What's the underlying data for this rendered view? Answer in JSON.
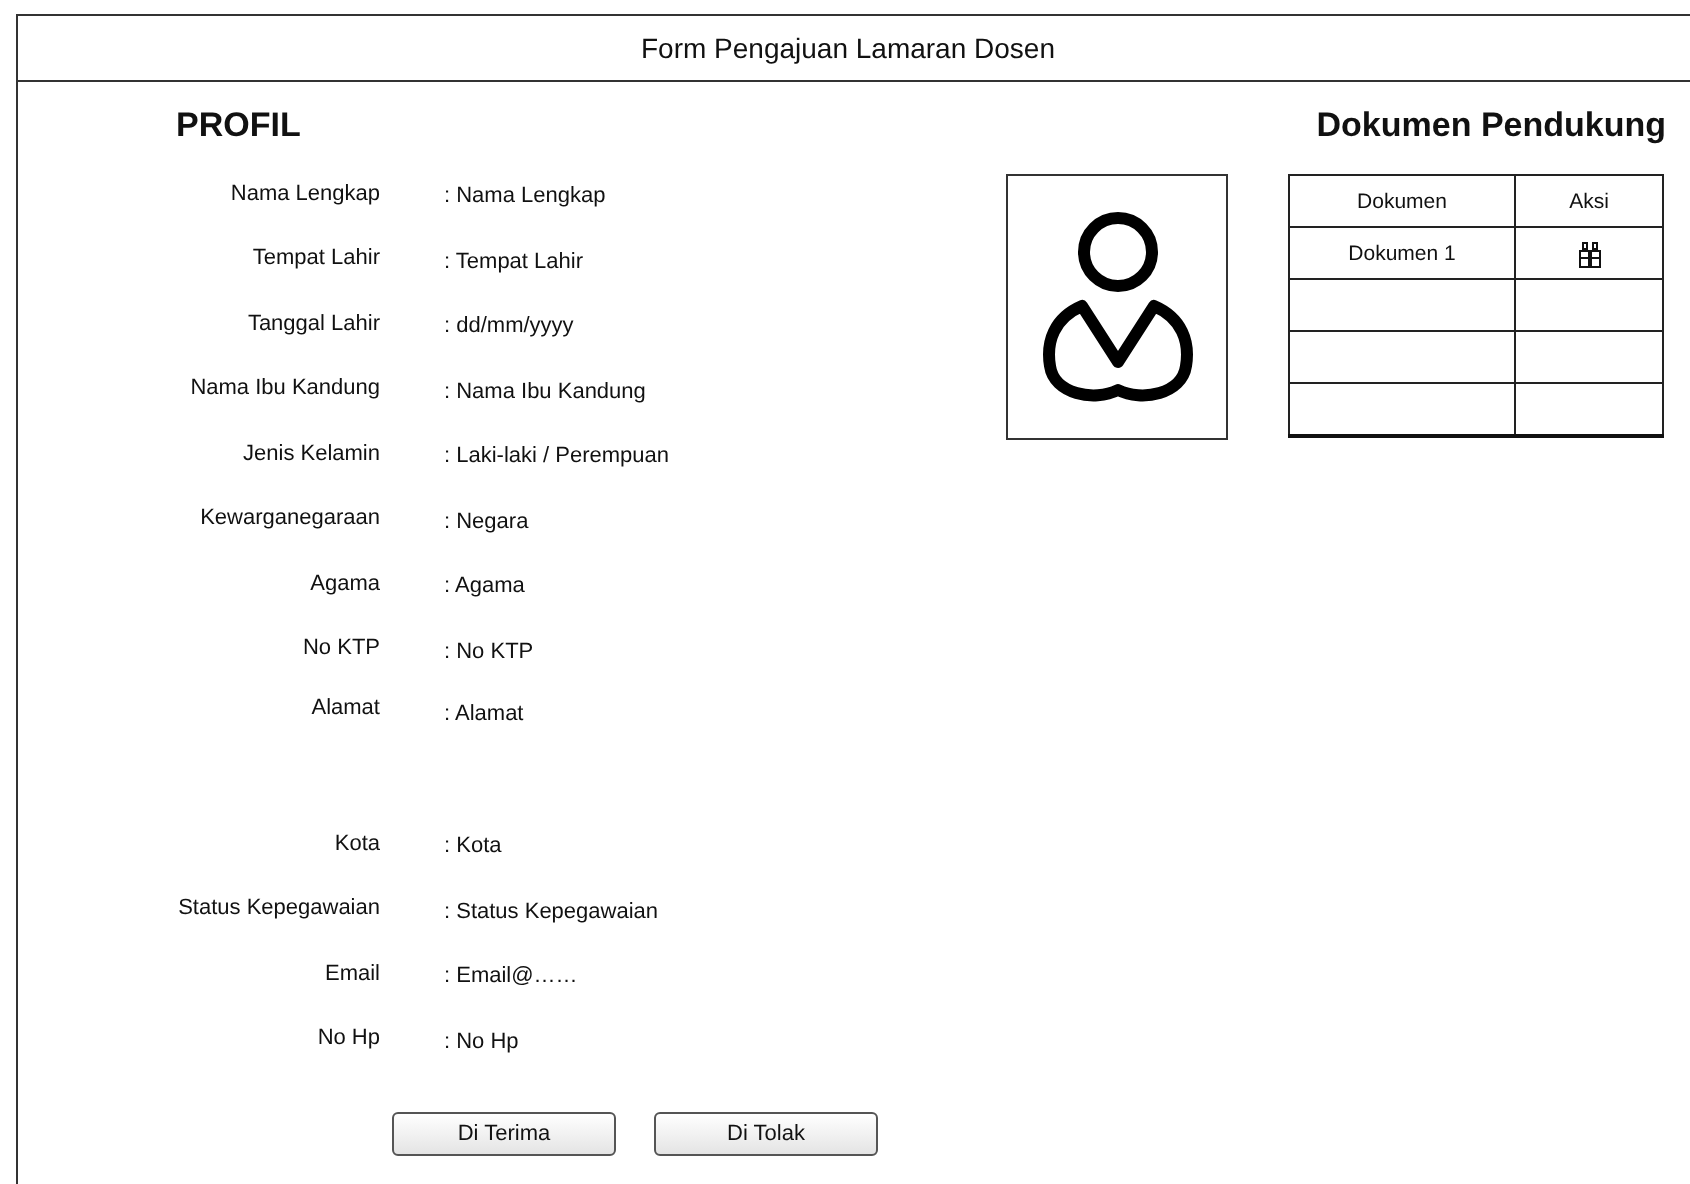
{
  "window": {
    "title": "Form Pengajuan Lamaran Dosen"
  },
  "profile": {
    "heading": "PROFIL",
    "fields": [
      {
        "label": "Nama Lengkap",
        "value": ": Nama Lengkap",
        "kind": "line"
      },
      {
        "label": "Tempat Lahir",
        "value": ": Tempat Lahir",
        "kind": "line"
      },
      {
        "label": "Tanggal Lahir",
        "value": ": dd/mm/yyyy",
        "kind": "line"
      },
      {
        "label": "Nama Ibu Kandung",
        "value": ": Nama Ibu Kandung",
        "kind": "line"
      },
      {
        "label": "Jenis Kelamin",
        "value": ": Laki-laki / Perempuan",
        "kind": "line"
      },
      {
        "label": "Kewarganegaraan",
        "value": ": Negara",
        "kind": "line"
      },
      {
        "label": "Agama",
        "value": ": Agama",
        "kind": "line"
      },
      {
        "label": "No KTP",
        "value": ": No KTP",
        "kind": "line"
      },
      {
        "label": "Alamat",
        "value": ": Alamat",
        "kind": "area"
      },
      {
        "label": "Kota",
        "value": ": Kota",
        "kind": "line"
      },
      {
        "label": "Status Kepegawaian",
        "value": ": Status Kepegawaian",
        "kind": "line"
      },
      {
        "label": "Email",
        "value": ": Email@……",
        "kind": "line"
      },
      {
        "label": "No Hp",
        "value": ": No Hp",
        "kind": "line"
      }
    ]
  },
  "documents": {
    "heading": "Dokumen Pendukung",
    "columns": [
      "Dokumen",
      "Aksi"
    ],
    "rows": [
      {
        "kind": "document",
        "name": "Dokumen 1"
      },
      {
        "kind": "blank"
      },
      {
        "kind": "blank"
      },
      {
        "kind": "blank"
      }
    ]
  },
  "buttons": [
    "Di Terima",
    "Di Tolak"
  ]
}
